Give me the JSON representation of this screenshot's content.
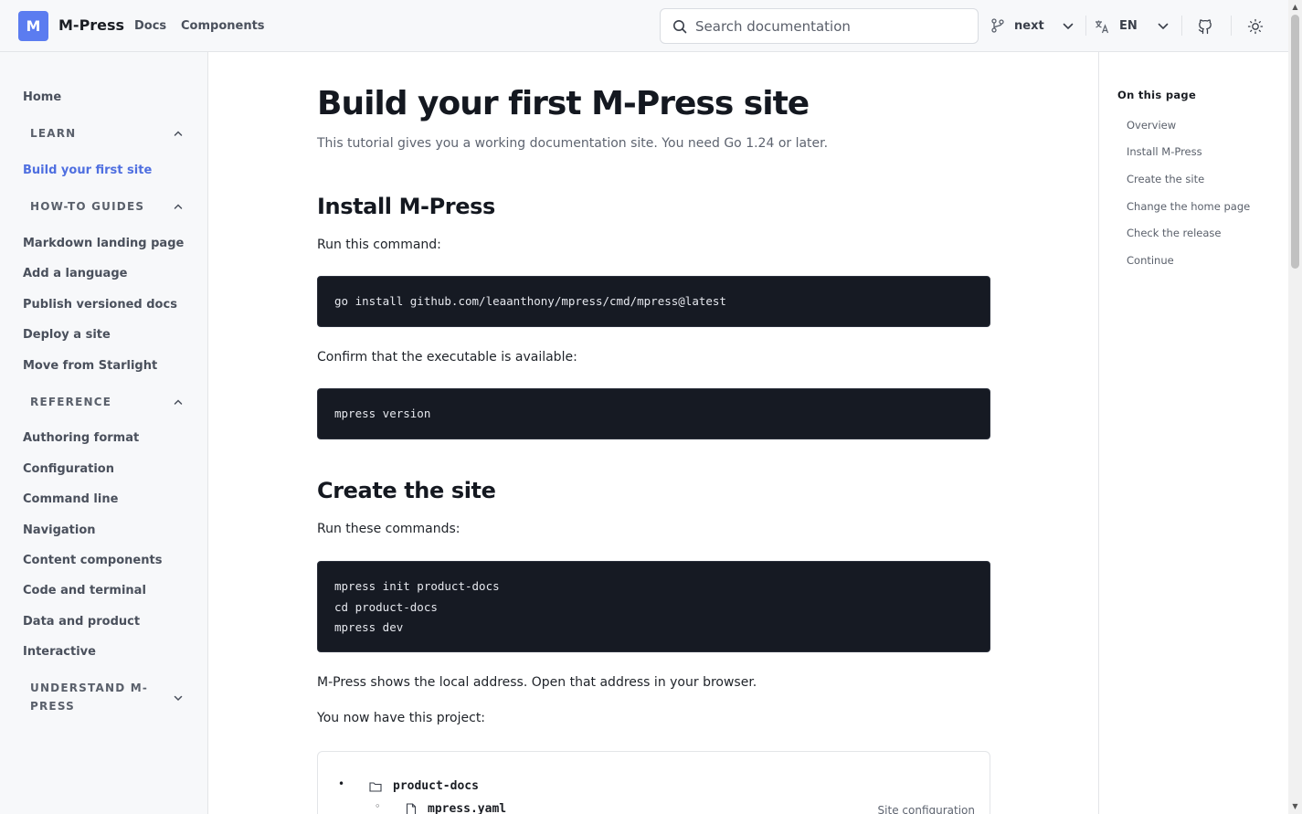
{
  "header": {
    "logo_letter": "M",
    "brand": "M-Press",
    "nav": [
      "Docs",
      "Components"
    ],
    "search_placeholder": "Search documentation",
    "version": "next",
    "language": "EN",
    "icons": [
      "search-icon",
      "branch-icon",
      "chevron-down-icon",
      "translate-icon",
      "github-icon",
      "sun-icon"
    ]
  },
  "sidebar": {
    "home": "Home",
    "groups": [
      {
        "label": "LEARN",
        "items": [
          "Build your first site"
        ]
      },
      {
        "label": "HOW-TO GUIDES",
        "items": [
          "Markdown landing page",
          "Add a language",
          "Publish versioned docs",
          "Deploy a site",
          "Move from Starlight"
        ]
      },
      {
        "label": "REFERENCE",
        "items": [
          "Authoring format",
          "Configuration",
          "Command line",
          "Navigation",
          "Content components",
          "Code and terminal",
          "Data and product",
          "Interactive"
        ]
      },
      {
        "label": "UNDERSTAND M-PRESS",
        "label_line1": "UNDERSTAND M-",
        "label_line2": "PRESS",
        "items": []
      }
    ],
    "accent_color": "#4f6fe0"
  },
  "main": {
    "title": "Build your first M-Press site",
    "lede": "This tutorial gives you a working documentation site. You need Go 1.24 or later.",
    "sections": [
      {
        "heading": "Install M-Press",
        "p1": "Run this command:",
        "code1": [
          "go install github.com/leaanthony/mpress/cmd/mpress@latest"
        ],
        "p2": "Confirm that the executable is available:",
        "code2": [
          "mpress version"
        ]
      },
      {
        "heading": "Create the site",
        "p1": "Run these commands:",
        "code1": [
          "mpress init product-docs",
          "cd product-docs",
          "mpress dev"
        ],
        "p2": "M-Press shows the local address. Open that address in your browser.",
        "p3": "You now have this project:"
      }
    ],
    "tree": {
      "root": "product-docs",
      "child": "mpress.yaml",
      "child_note": "Site configuration"
    }
  },
  "toc": {
    "title": "On this page",
    "items": [
      "Overview",
      "Install M-Press",
      "Create the site",
      "Change the home page",
      "Check the release",
      "Continue"
    ]
  }
}
